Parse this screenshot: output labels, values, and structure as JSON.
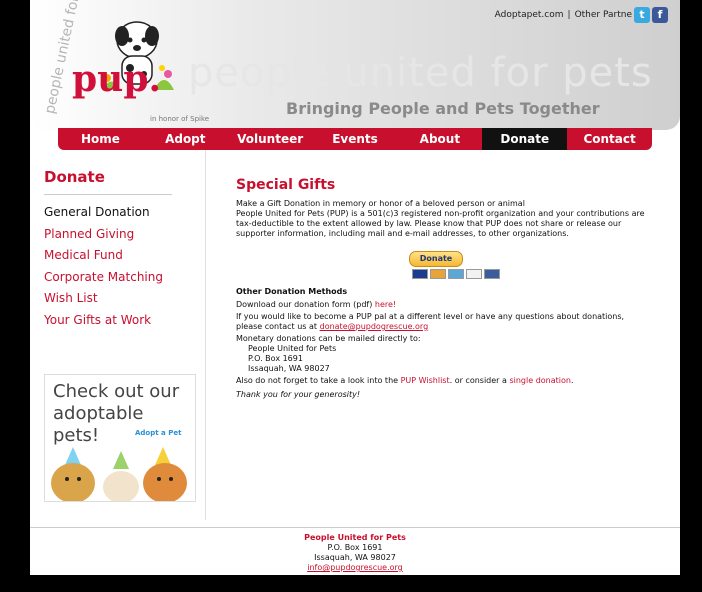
{
  "header": {
    "top_links": {
      "adoptapet": "Adoptapet.com",
      "separator": "|",
      "other_partners": "Other Partne"
    },
    "logo_arc_text": "people united for pets",
    "logo_main": "pup.",
    "logo_honor": "in honor of Spike",
    "banner_title": "people united for pets",
    "banner_subtitle": "Bringing People and Pets Together"
  },
  "nav": [
    "Home",
    "Adopt",
    "Volunteer",
    "Events",
    "About",
    "Donate",
    "Contact"
  ],
  "nav_active": "Donate",
  "sidebar": {
    "title": "Donate",
    "items": [
      "General Donation",
      "Planned Giving",
      "Medical Fund",
      "Corporate Matching",
      "Wish List",
      "Your Gifts at Work"
    ],
    "current": "General Donation",
    "ad": {
      "line1": "Check out our",
      "line2": "adoptable pets!",
      "brand": "Adopt a Pet"
    }
  },
  "content": {
    "heading": "Special Gifts",
    "intro": "Make a Gift Donation in memory or honor of a beloved person or animal",
    "para1": "People United for Pets (PUP) is a 501(c)3 registered non-profit organization and your contributions are tax-deductible to the extent allowed by law. Please know that PUP does not share or release our supporter information, including mail and e-mail addresses, to other organizations.",
    "donate_button": "Donate",
    "other_methods": "Other Donation Methods",
    "download_text": "Download our donation form (pdf)",
    "download_link": "here!",
    "pal_text": "If you would like to become a PUP pal at a different level or have any questions about donations, please contact us at",
    "pal_email": "donate@pupdogrescue.org",
    "mail_intro": "Monetary donations can be mailed directly to:",
    "address": [
      "People United for Pets",
      "P.O. Box 1691",
      "Issaquah, WA 98027"
    ],
    "also_pre": "Also do not forget to take a look into the",
    "wishlist_link": "PUP Wishlist",
    "also_mid": ". or consider a",
    "single_link": "single donation",
    "also_end": ".",
    "thanks": "Thank you for your generosity!"
  },
  "footer": {
    "name": "People United for Pets",
    "box": "P.O. Box 1691",
    "city": "Issaquah, WA 98027",
    "email": "info@pupdogrescue.org"
  },
  "colors": {
    "accent": "#c8102e",
    "nav_active": "#111111"
  }
}
